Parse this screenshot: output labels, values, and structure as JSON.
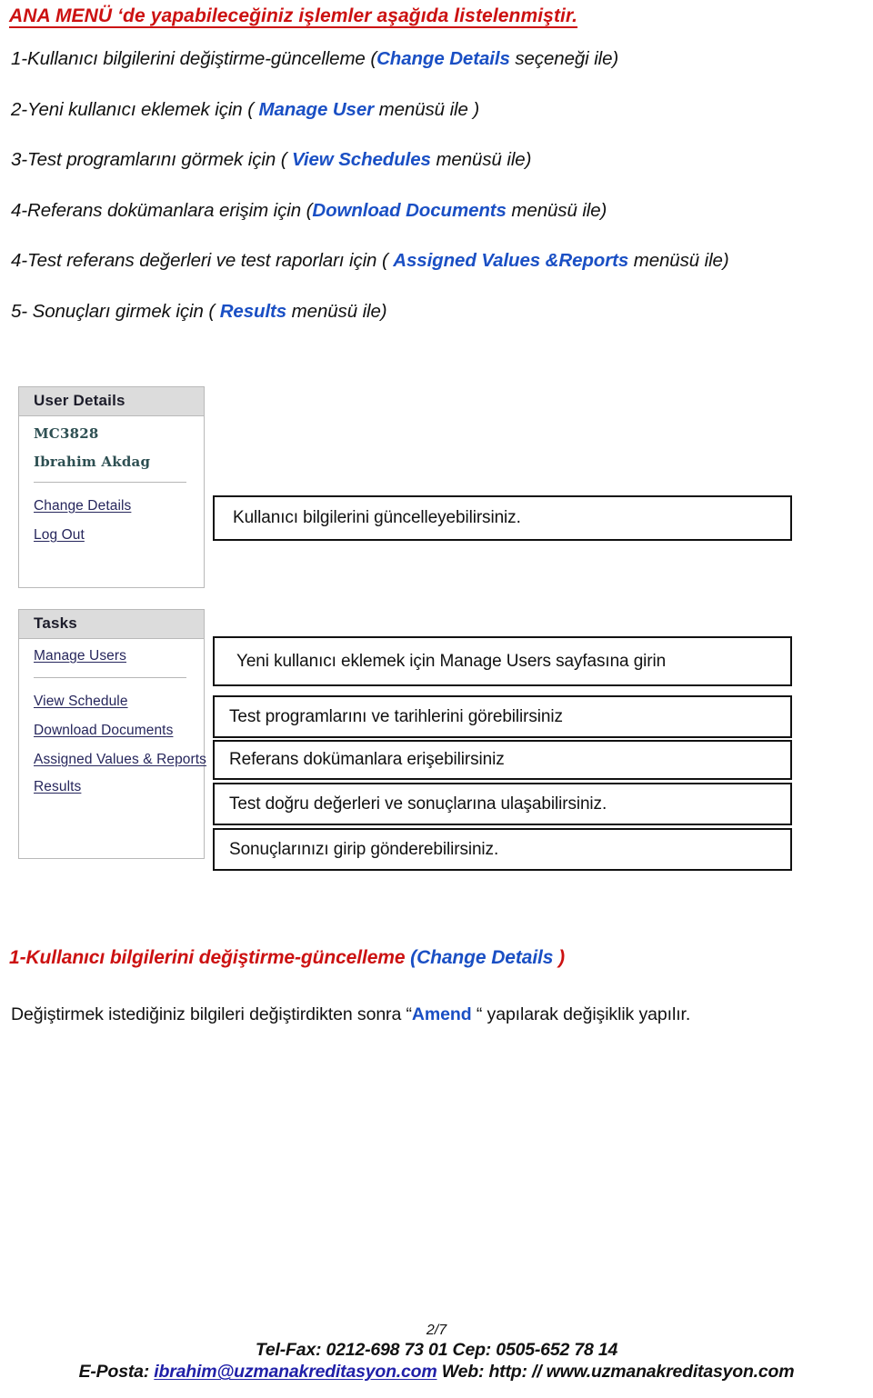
{
  "document": {
    "heading": "ANA MENÜ ‘de yapabileceğiniz işlemler aşağıda listelenmiştir.",
    "menu_list": [
      {
        "before": "1-Kullanıcı bilgilerini değiştirme-güncelleme (",
        "menu": "Change Details",
        "after": "  seçeneği ile)"
      },
      {
        "before": "2-Yeni kullanıcı eklemek için ( ",
        "menu": "Manage User",
        "after": " menüsü ile )"
      },
      {
        "before": "3-Test programlarını görmek için  ( ",
        "menu": "View Schedules",
        "after": " menüsü ile)"
      },
      {
        "before": "4-Referans  dokümanlara erişim için (",
        "menu": "Download  Documents",
        "after": "  menüsü ile)"
      },
      {
        "before": "4-Test referans değerleri ve test raporları için  ( ",
        "menu": "Assigned Values &Reports",
        "after": " menüsü ile)"
      },
      {
        "before": "5- Sonuçları girmek için ( ",
        "menu": "Results",
        "after": " menüsü ile)"
      }
    ]
  },
  "screenshot": {
    "user_panel": {
      "title": "User Details",
      "user_id": "MC3828",
      "user_name": "Ibrahim Akdag",
      "links": [
        "Change Details",
        "Log Out"
      ]
    },
    "tasks_panel": {
      "title": "Tasks",
      "primary_link": "Manage Users",
      "links": [
        "View Schedule",
        "Download Documents",
        "Assigned Values & Reports",
        "Results"
      ]
    },
    "callouts": [
      "Kullanıcı bilgilerini güncelleyebilirsiniz.",
      "Yeni kullanıcı eklemek için Manage  Users     sayfasına girin",
      "Test programlarını ve tarihlerini görebilirsiniz",
      "Referans dokümanlara erişebilirsiniz",
      "Test  doğru değerleri ve sonuçlarına ulaşabilirsiniz.",
      "Sonuçlarınızı girip gönderebilirsiniz."
    ]
  },
  "section": {
    "heading_before": "1-Kullanıcı bilgilerini değiştirme-güncelleme ",
    "heading_menu": "(Change Details ",
    "heading_after": ")",
    "para_before": "Değiştirmek istediğiniz bilgileri değiştirdikten sonra  “",
    "para_amend": "Amend",
    "para_after": " “    yapılarak değişiklik yapılır."
  },
  "footer": {
    "page_number": "2/7",
    "contact": "Tel-Fax: 0212-698 73 01 Cep: 0505-652 78 14",
    "email_label": "E-Posta: ",
    "email": "ibrahim@uzmanakreditasyon.com",
    "web": "   Web: http: // www.uzmanakreditasyon.com"
  },
  "colors": {
    "heading_red": "#cc1111",
    "menu_blue": "#1a4fc4",
    "link_navy": "#26265c",
    "panel_header_gray": "#dcdcdc",
    "user_teal": "#2d4f52"
  }
}
